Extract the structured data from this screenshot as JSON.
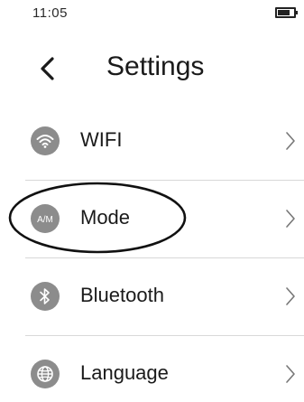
{
  "status_bar": {
    "time": "11:05",
    "battery_level": 0.85,
    "battery_icon": "battery-icon"
  },
  "header": {
    "back_icon": "back-chevron-icon",
    "title": "Settings"
  },
  "menu": {
    "items": [
      {
        "label": "WIFI",
        "icon": "wifi-icon"
      },
      {
        "label": "Mode",
        "icon": "am-mode-icon",
        "icon_text": "A/M"
      },
      {
        "label": "Bluetooth",
        "icon": "bluetooth-icon"
      },
      {
        "label": "Language",
        "icon": "globe-icon"
      }
    ],
    "chevron_icon": "chevron-right-icon"
  },
  "colors": {
    "icon_background": "#8c8c8c",
    "text": "#1a1a1a",
    "divider": "#d8d8d8",
    "annotation": "#111111"
  }
}
